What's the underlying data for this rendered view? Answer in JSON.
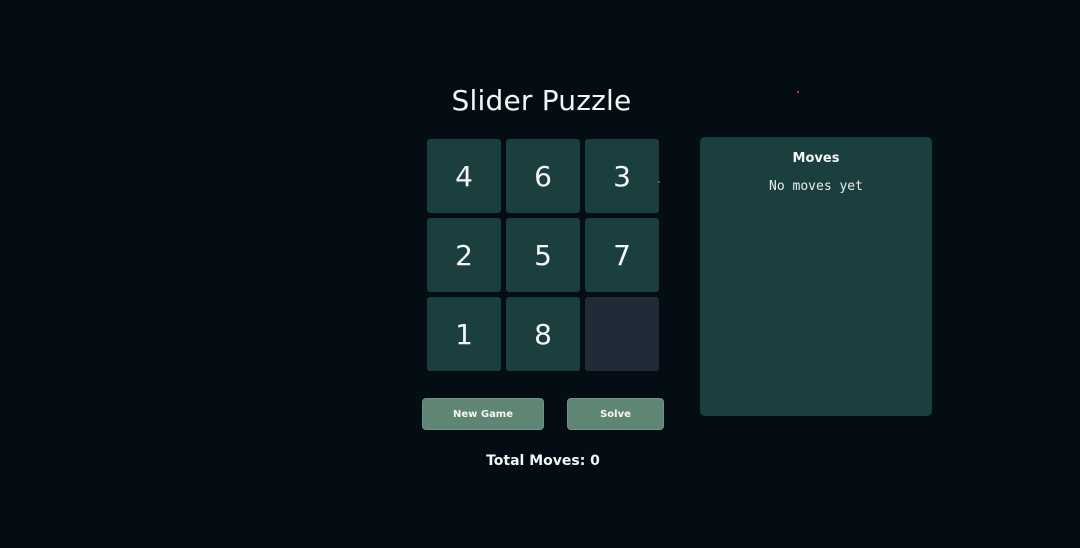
{
  "title": "Slider Puzzle",
  "board": {
    "rows": 3,
    "cols": 3,
    "tiles": [
      "4",
      "6",
      "3",
      "2",
      "5",
      "7",
      "1",
      "8",
      ""
    ],
    "empty_index": 8
  },
  "buttons": {
    "new_game": "New Game",
    "solve": "Solve"
  },
  "total_moves": {
    "label": "Total Moves: 0",
    "value": 0
  },
  "moves_panel": {
    "title": "Moves",
    "empty_text": "No moves yet",
    "moves": []
  },
  "colors": {
    "background": "#050d14",
    "tile": "#1b3f3f",
    "empty_tile": "#212b38",
    "button": "#5f8674",
    "panel": "#1b3f3f"
  }
}
